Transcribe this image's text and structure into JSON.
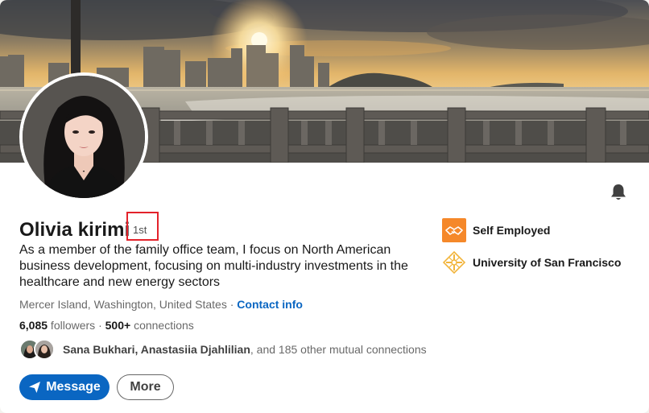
{
  "profile": {
    "name": "Olivia kirimi",
    "degree": "1st",
    "headline": "As a member of the family office team, I focus on North American business development, focusing on multi-industry investments in the healthcare and new energy sectors",
    "location": "Mercer Island, Washington, United States",
    "separator": " · ",
    "contact_info": "Contact info",
    "followers": "6,085",
    "followers_label": " followers",
    "connections_sep": " · ",
    "connections": "500+",
    "connections_label": " connections"
  },
  "mutual": {
    "names": "Sana Bukhari, Anastasiia Djahlilian",
    "rest": ", and 185 other mutual connections"
  },
  "actions": {
    "message": "Message",
    "more": "More"
  },
  "experience": {
    "company": "Self Employed",
    "school": "University of San Francisco"
  },
  "colors": {
    "accent": "#0a66c2",
    "highlight_box": "#e3222b",
    "company_logo": "#f5882a",
    "school_logo": "#f2b53c"
  },
  "icons": {
    "bell": "bell-icon",
    "send": "paper-plane-icon",
    "company": "handshake-icon",
    "school": "university-crest-icon"
  }
}
